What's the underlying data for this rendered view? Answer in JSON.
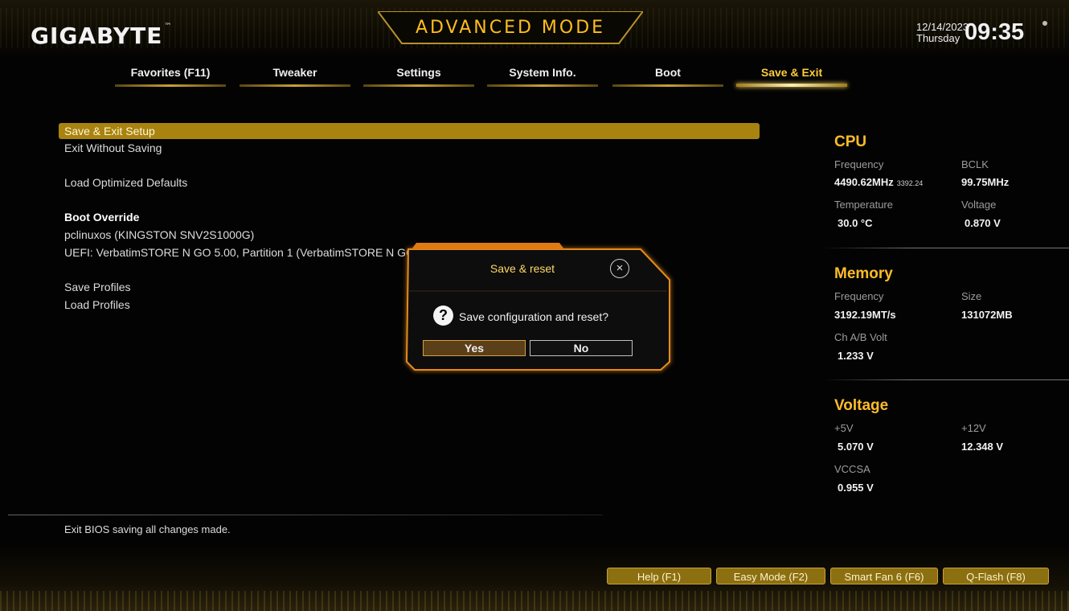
{
  "header": {
    "logo": "GIGABYTE",
    "logo_tm": "™",
    "mode_title": "ADVANCED MODE",
    "date": "12/14/2023",
    "day": "Thursday",
    "time": "09:35"
  },
  "tabs": [
    {
      "label": "Favorites (F11)",
      "active": false
    },
    {
      "label": "Tweaker",
      "active": false
    },
    {
      "label": "Settings",
      "active": false
    },
    {
      "label": "System Info.",
      "active": false
    },
    {
      "label": "Boot",
      "active": false
    },
    {
      "label": "Save & Exit",
      "active": true
    }
  ],
  "menu": {
    "save_exit_setup": "Save & Exit Setup",
    "exit_without_saving": "Exit Without Saving",
    "load_optimized_defaults": "Load Optimized Defaults",
    "boot_override_header": "Boot Override",
    "boot_entries": [
      "pclinuxos (KINGSTON SNV2S1000G)",
      "UEFI: VerbatimSTORE N GO 5.00, Partition 1 (VerbatimSTORE N GO 5.00)"
    ],
    "save_profiles": "Save Profiles",
    "load_profiles": "Load Profiles"
  },
  "help_text": "Exit BIOS saving all changes made.",
  "status": {
    "cpu": {
      "title": "CPU",
      "frequency_label": "Frequency",
      "frequency_value": "4490.62MHz",
      "frequency_sub": "3392.24",
      "bclk_label": "BCLK",
      "bclk_value": "99.75MHz",
      "temperature_label": "Temperature",
      "temperature_value": "30.0 °C",
      "voltage_label": "Voltage",
      "voltage_value": "0.870 V"
    },
    "memory": {
      "title": "Memory",
      "frequency_label": "Frequency",
      "frequency_value": "3192.19MT/s",
      "size_label": "Size",
      "size_value": "131072MB",
      "chab_label": "Ch A/B Volt",
      "chab_value": "1.233 V"
    },
    "voltage": {
      "title": "Voltage",
      "v5_label": "+5V",
      "v5_value": "5.070 V",
      "v12_label": "+12V",
      "v12_value": "12.348 V",
      "vccsa_label": "VCCSA",
      "vccsa_value": "0.955 V"
    }
  },
  "footer_buttons": [
    {
      "label": "Help (F1)"
    },
    {
      "label": "Easy Mode (F2)"
    },
    {
      "label": "Smart Fan 6 (F6)"
    },
    {
      "label": "Q-Flash (F8)"
    }
  ],
  "dialog": {
    "title": "Save & reset",
    "close_glyph": "×",
    "question_glyph": "?",
    "message": "Save configuration and reset?",
    "yes_label": "Yes",
    "no_label": "No"
  },
  "colors": {
    "accent": "#ffbc2a",
    "selection": "#a8830f",
    "dialog_border": "#e58a1c"
  }
}
